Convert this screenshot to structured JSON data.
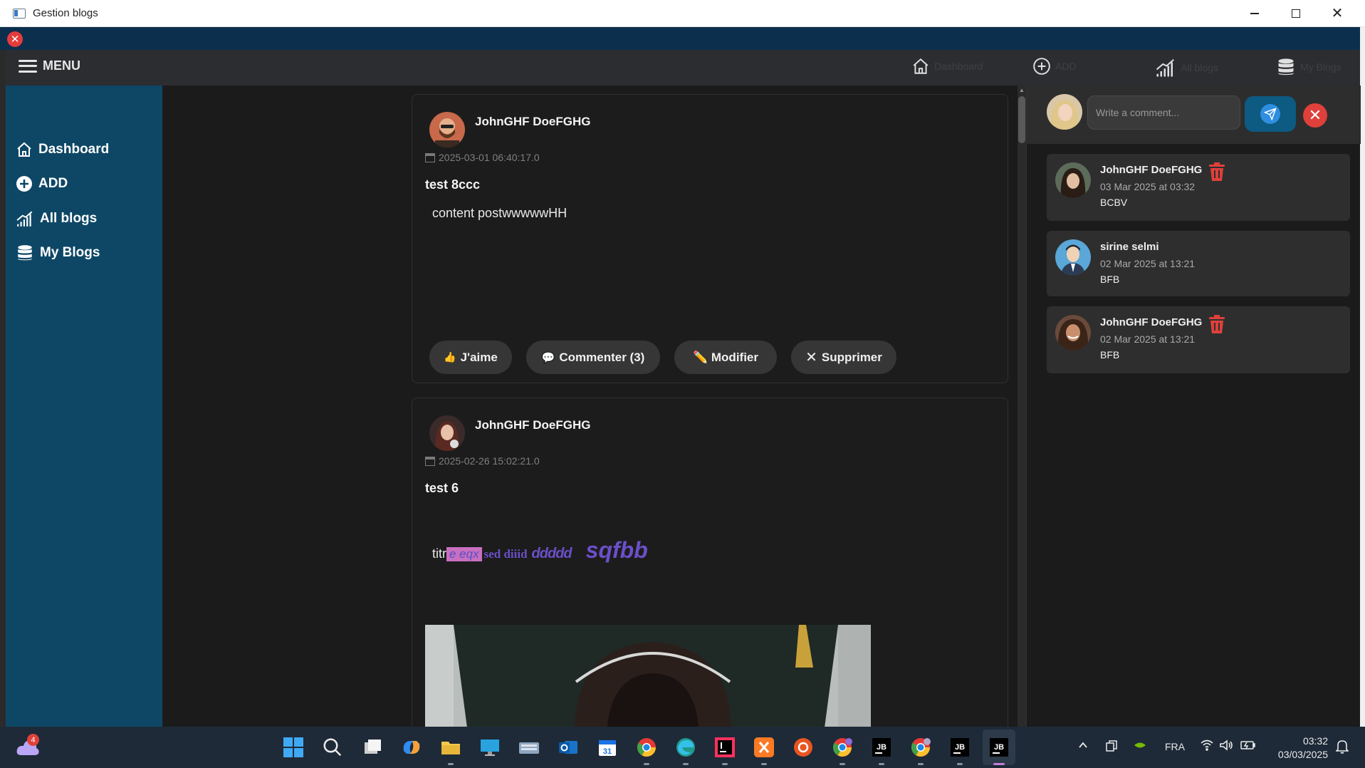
{
  "window": {
    "title": "Gestion blogs"
  },
  "nav": {
    "menu_label": "MENU",
    "icons": [
      {
        "name": "home-icon",
        "label": "Dashboard"
      },
      {
        "name": "add-circle-icon",
        "label": "ADD"
      },
      {
        "name": "chart-icon",
        "label": "All blogs"
      },
      {
        "name": "database-icon",
        "label": "My Blogs"
      }
    ]
  },
  "sidebar": {
    "items": [
      {
        "label": "Dashboard",
        "icon": "home-icon"
      },
      {
        "label": "ADD",
        "icon": "add-circle-icon"
      },
      {
        "label": "All blogs",
        "icon": "chart-icon"
      },
      {
        "label": "My Blogs",
        "icon": "database-icon"
      }
    ]
  },
  "posts": [
    {
      "author": "JohnGHF DoeFGHG",
      "date": "2025-03-01 06:40:17.0",
      "title": "test 8ccc",
      "content": "content postwwwwwHH",
      "buttons": {
        "like": "J'aime",
        "comment": "Commenter (3)",
        "edit": "✏️ Modifier",
        "delete": "Supprimer"
      }
    },
    {
      "author": "JohnGHF DoeFGHG",
      "date": "2025-02-26 15:02:21.0",
      "title": "test 6",
      "rich": {
        "plain": "titr",
        "highlight": "e eqx ",
        "serif": "sed diiid",
        "deco1": "ddddd",
        "deco2": "sqfbb"
      }
    }
  ],
  "comments_panel": {
    "placeholder": "Write a comment...",
    "comments": [
      {
        "author": "JohnGHF DoeFGHG",
        "date": "03 Mar 2025 at 03:32",
        "text": "BCBV",
        "deletable": true
      },
      {
        "author": "sirine selmi",
        "date": "02 Mar 2025 at 13:21",
        "text": "BFB",
        "deletable": false
      },
      {
        "author": "JohnGHF DoeFGHG",
        "date": "02 Mar 2025 at 13:21",
        "text": "BFB",
        "deletable": true
      }
    ]
  },
  "taskbar": {
    "badge_count": "4",
    "language": "FRA",
    "time": "03:32",
    "date": "03/03/2025"
  },
  "colors": {
    "sidebar": "#0e4766",
    "navbar": "#2b2d30",
    "content_bg": "#1b1b1b",
    "accent_red": "#e0403b",
    "send_blue": "#0d5a82"
  }
}
